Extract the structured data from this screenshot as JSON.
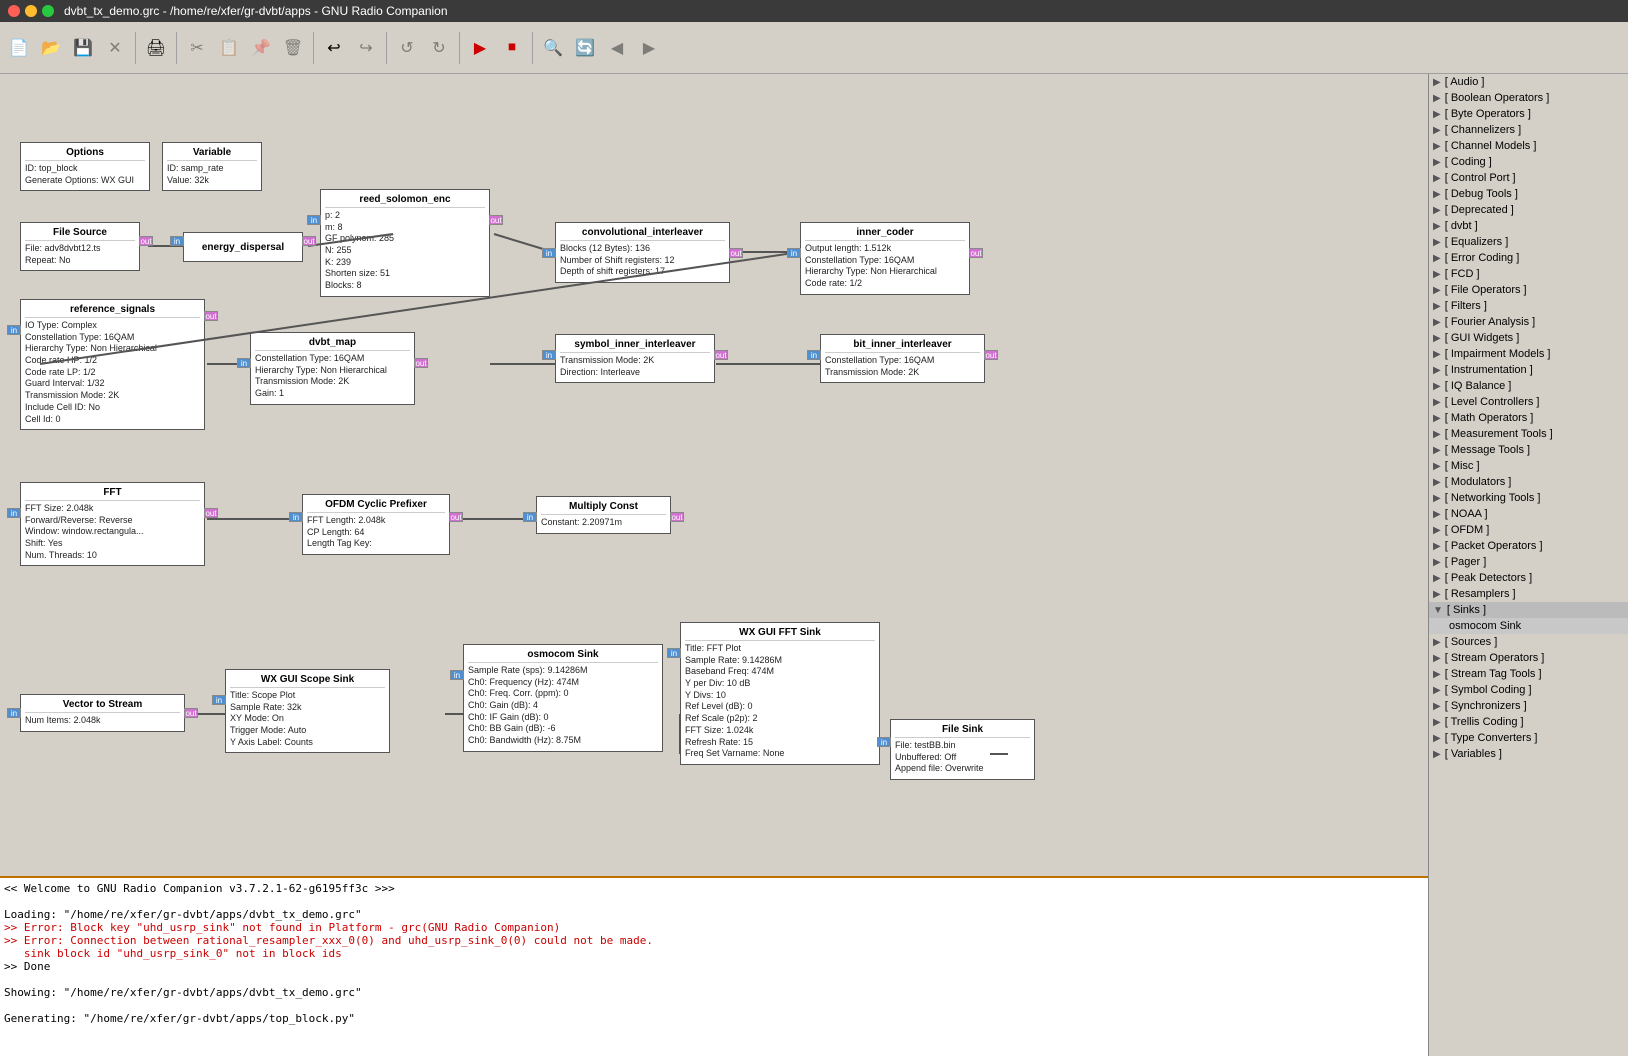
{
  "window": {
    "title": "dvbt_tx_demo.grc - /home/re/xfer/gr-dvbt/apps - GNU Radio Companion",
    "buttons": [
      "close",
      "minimize",
      "maximize"
    ]
  },
  "toolbar": {
    "buttons": [
      {
        "name": "new",
        "icon": "📄",
        "disabled": false
      },
      {
        "name": "open",
        "icon": "📂",
        "disabled": false
      },
      {
        "name": "save",
        "icon": "💾",
        "disabled": false
      },
      {
        "name": "close",
        "icon": "✕",
        "disabled": false
      },
      {
        "name": "print",
        "icon": "🖨",
        "disabled": false
      },
      {
        "name": "cut",
        "icon": "✂",
        "disabled": false
      },
      {
        "name": "copy",
        "icon": "📋",
        "disabled": false
      },
      {
        "name": "paste",
        "icon": "📌",
        "disabled": false
      },
      {
        "name": "delete",
        "icon": "🗑",
        "disabled": false
      },
      {
        "name": "undo",
        "icon": "↩",
        "disabled": false
      },
      {
        "name": "redo",
        "icon": "↪",
        "disabled": false
      },
      {
        "name": "rotate-ccw",
        "icon": "↺",
        "disabled": false
      },
      {
        "name": "run",
        "icon": "▶",
        "disabled": false
      },
      {
        "name": "stop",
        "icon": "⏹",
        "disabled": false
      },
      {
        "name": "search",
        "icon": "🔍",
        "disabled": false
      },
      {
        "name": "refresh",
        "icon": "🔄",
        "disabled": false
      }
    ]
  },
  "blocks": {
    "options": {
      "title": "Options",
      "props": [
        "ID: top_block",
        "Generate Options: WX GUI"
      ]
    },
    "variable": {
      "title": "Variable",
      "props": [
        "ID: samp_rate",
        "Value: 32k"
      ]
    },
    "file_source": {
      "title": "File Source",
      "props": [
        "File: adv8dvbt12.ts",
        "Repeat: No"
      ]
    },
    "energy_dispersal": {
      "title": "energy_dispersal",
      "props": []
    },
    "reed_solomon": {
      "title": "reed_solomon_enc",
      "props": [
        "p: 2",
        "m: 8",
        "GF polynom: 285",
        "N: 255",
        "K: 239",
        "Shorten size: 51",
        "Blocks: 8"
      ]
    },
    "convolutional_interleaver": {
      "title": "convolutional_interleaver",
      "props": [
        "Blocks (12 Bytes): 136",
        "Number of Shift registers: 12",
        "Depth of shift registers: 17"
      ]
    },
    "inner_coder": {
      "title": "inner_coder",
      "props": [
        "Output length: 1.512k",
        "Constellation Type: 16QAM",
        "Hierarchy Type: Non Hierarchical",
        "Code rate: 1/2"
      ]
    },
    "reference_signals": {
      "title": "reference_signals",
      "props": [
        "IO Type: Complex",
        "Constellation Type: 16QAM",
        "Hierarchy Type: Non Hierarchical",
        "Code rate HP: 1/2",
        "Code rate LP: 1/2",
        "Guard Interval: 1/32",
        "Transmission Mode: 2K",
        "Include Cell ID: No",
        "Cell Id: 0"
      ]
    },
    "dvbt_map": {
      "title": "dvbt_map",
      "props": [
        "Constellation Type: 16QAM",
        "Hierarchy Type: Non Hierarchical",
        "Transmission Mode: 2K",
        "Gain: 1"
      ]
    },
    "symbol_inner_interleaver": {
      "title": "symbol_inner_interleaver",
      "props": [
        "Transmission Mode: 2K",
        "Direction: Interleave"
      ]
    },
    "bit_inner_interleaver": {
      "title": "bit_inner_interleaver",
      "props": [
        "Constellation Type: 16QAM",
        "Transmission Mode: 2K"
      ]
    },
    "fft": {
      "title": "FFT",
      "props": [
        "FFT Size: 2.048k",
        "Forward/Reverse: Reverse",
        "Window: window.rectangula...",
        "Shift: Yes",
        "Num. Threads: 10"
      ]
    },
    "ofdm_cyclic": {
      "title": "OFDM Cyclic Prefixer",
      "props": [
        "FFT Length: 2.048k",
        "CP Length: 64",
        "Length Tag Key:"
      ]
    },
    "multiply_const": {
      "title": "Multiply Const",
      "props": [
        "Constant: 2.20971m"
      ]
    },
    "wx_gui_scope": {
      "title": "WX GUI Scope Sink",
      "props": [
        "Title: Scope Plot",
        "Sample Rate: 32k",
        "XY Mode: On",
        "Trigger Mode: Auto",
        "Y Axis Label: Counts"
      ]
    },
    "vector_to_stream": {
      "title": "Vector to Stream",
      "props": [
        "Num Items: 2.048k"
      ]
    },
    "osmocom_sink": {
      "title": "osmocom Sink",
      "props": [
        "Sample Rate (sps): 9.14286M",
        "Ch0: Frequency (Hz): 474M",
        "Ch0: Freq. Corr. (ppm): 0",
        "Ch0: Gain (dB): 4",
        "Ch0: IF Gain (dB): 0",
        "Ch0: BB Gain (dB): -6",
        "Ch0: Bandwidth (Hz): 8.75M"
      ]
    },
    "wx_gui_fft": {
      "title": "WX GUI FFT Sink",
      "props": [
        "Title: FFT Plot",
        "Sample Rate: 9.14286M",
        "Baseband Freq: 474M",
        "Y per Div: 10 dB",
        "Y Divs: 10",
        "Ref Level (dB): 0",
        "Ref Scale (p2p): 2",
        "FFT Size: 1.024k",
        "Refresh Rate: 15",
        "Freq Set Varname: None"
      ]
    },
    "file_sink": {
      "title": "File Sink",
      "props": [
        "File: testBB.bin",
        "Unbuffered: Off",
        "Append file: Overwrite"
      ]
    }
  },
  "right_panel": {
    "items": [
      {
        "label": "[ Audio ]",
        "expanded": false
      },
      {
        "label": "[ Boolean Operators ]",
        "expanded": false
      },
      {
        "label": "[ Byte Operators ]",
        "expanded": false
      },
      {
        "label": "[ Channelizers ]",
        "expanded": false
      },
      {
        "label": "[ Channel Models ]",
        "expanded": false
      },
      {
        "label": "[ Coding ]",
        "expanded": false
      },
      {
        "label": "[ Control Port ]",
        "expanded": false
      },
      {
        "label": "[ Debug Tools ]",
        "expanded": false
      },
      {
        "label": "[ Deprecated ]",
        "expanded": false
      },
      {
        "label": "[ dvbt ]",
        "expanded": false
      },
      {
        "label": "[ Equalizers ]",
        "expanded": false
      },
      {
        "label": "[ Error Coding ]",
        "expanded": false
      },
      {
        "label": "[ FCD ]",
        "expanded": false
      },
      {
        "label": "[ File Operators ]",
        "expanded": false
      },
      {
        "label": "[ Filters ]",
        "expanded": false
      },
      {
        "label": "[ Fourier Analysis ]",
        "expanded": false
      },
      {
        "label": "[ GUI Widgets ]",
        "expanded": false
      },
      {
        "label": "[ Impairment Models ]",
        "expanded": false
      },
      {
        "label": "[ Instrumentation ]",
        "expanded": false
      },
      {
        "label": "[ IQ Balance ]",
        "expanded": false
      },
      {
        "label": "[ Level Controllers ]",
        "expanded": false
      },
      {
        "label": "[ Math Operators ]",
        "expanded": false
      },
      {
        "label": "[ Measurement Tools ]",
        "expanded": false
      },
      {
        "label": "[ Message Tools ]",
        "expanded": false
      },
      {
        "label": "[ Misc ]",
        "expanded": false
      },
      {
        "label": "[ Modulators ]",
        "expanded": false
      },
      {
        "label": "[ Networking Tools ]",
        "expanded": false
      },
      {
        "label": "[ NOAA ]",
        "expanded": false
      },
      {
        "label": "[ OFDM ]",
        "expanded": false
      },
      {
        "label": "[ Packet Operators ]",
        "expanded": false
      },
      {
        "label": "[ Pager ]",
        "expanded": false
      },
      {
        "label": "[ Peak Detectors ]",
        "expanded": false
      },
      {
        "label": "[ Resamplers ]",
        "expanded": false
      },
      {
        "label": "[ Sinks ]",
        "expanded": true,
        "sub": [
          "osmocom Sink"
        ]
      },
      {
        "label": "[ Sources ]",
        "expanded": false
      },
      {
        "label": "[ Stream Operators ]",
        "expanded": false
      },
      {
        "label": "[ Stream Tag Tools ]",
        "expanded": false
      },
      {
        "label": "[ Symbol Coding ]",
        "expanded": false
      },
      {
        "label": "[ Synchronizers ]",
        "expanded": false
      },
      {
        "label": "[ Trellis Coding ]",
        "expanded": false
      },
      {
        "label": "[ Type Converters ]",
        "expanded": false
      },
      {
        "label": "[ Variables ]",
        "expanded": false
      }
    ]
  },
  "console": {
    "lines": [
      "<< Welcome to GNU Radio Companion v3.7.2.1-62-g6195ff3c >>>",
      "",
      "Loading: \"/home/re/xfer/gr-dvbt/apps/dvbt_tx_demo.grc\"",
      ">> Error: Block key \"uhd_usrp_sink\" not found in Platform - grc(GNU Radio Companion)",
      ">> Error: Connection between rational_resampler_xxx_0(0) and uhd_usrp_sink_0(0) could not be made.",
      "   sink block id \"uhd_usrp_sink_0\" not in block ids",
      ">> Done",
      "",
      "Showing: \"/home/re/xfer/gr-dvbt/apps/dvbt_tx_demo.grc\"",
      "",
      "Generating: \"/home/re/xfer/gr-dvbt/apps/top_block.py\""
    ]
  }
}
